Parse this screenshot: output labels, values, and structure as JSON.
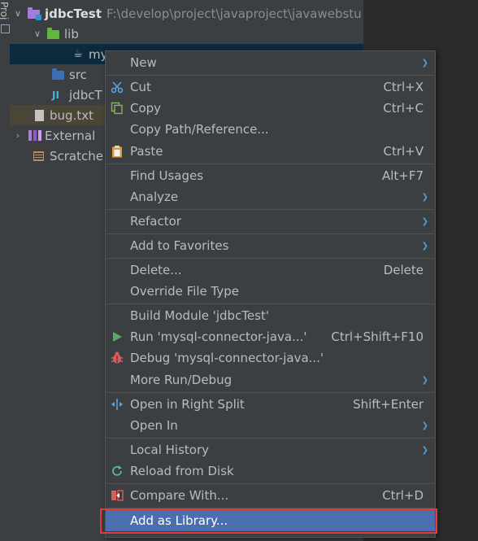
{
  "side_tab": {
    "label": "Proj"
  },
  "tree": {
    "items": [
      {
        "name": "jdbcTest",
        "path": "F:\\develop\\project\\javaproject\\javawebstu"
      },
      {
        "name": "lib"
      },
      {
        "name": "my"
      },
      {
        "name": "src"
      },
      {
        "name": "jdbcT"
      },
      {
        "name": "bug.txt"
      },
      {
        "name": "External"
      },
      {
        "name": "Scratche"
      }
    ]
  },
  "menu": {
    "items": [
      {
        "id": "new",
        "label": "New",
        "shortcut": "",
        "submenu": true
      },
      {
        "id": "cut",
        "label": "Cut",
        "shortcut": "Ctrl+X",
        "icon": "scissors-icon"
      },
      {
        "id": "copy",
        "label": "Copy",
        "shortcut": "Ctrl+C",
        "icon": "copy-icon"
      },
      {
        "id": "copy-path",
        "label": "Copy Path/Reference...",
        "shortcut": ""
      },
      {
        "id": "paste",
        "label": "Paste",
        "shortcut": "Ctrl+V",
        "icon": "clipboard-icon"
      },
      {
        "id": "find-usages",
        "label": "Find Usages",
        "shortcut": "Alt+F7"
      },
      {
        "id": "analyze",
        "label": "Analyze",
        "shortcut": "",
        "submenu": true
      },
      {
        "id": "refactor",
        "label": "Refactor",
        "shortcut": "",
        "submenu": true
      },
      {
        "id": "add-favorites",
        "label": "Add to Favorites",
        "shortcut": "",
        "submenu": true
      },
      {
        "id": "delete",
        "label": "Delete...",
        "shortcut": "Delete"
      },
      {
        "id": "override-type",
        "label": "Override File Type",
        "shortcut": ""
      },
      {
        "id": "build-module",
        "label": "Build Module 'jdbcTest'",
        "shortcut": ""
      },
      {
        "id": "run",
        "label": "Run 'mysql-connector-java...'",
        "shortcut": "Ctrl+Shift+F10",
        "icon": "run-icon"
      },
      {
        "id": "debug",
        "label": "Debug 'mysql-connector-java...'",
        "shortcut": "",
        "icon": "debug-icon"
      },
      {
        "id": "more-run",
        "label": "More Run/Debug",
        "shortcut": "",
        "submenu": true
      },
      {
        "id": "open-right-split",
        "label": "Open in Right Split",
        "shortcut": "Shift+Enter",
        "icon": "split-icon"
      },
      {
        "id": "open-in",
        "label": "Open In",
        "shortcut": "",
        "submenu": true
      },
      {
        "id": "local-history",
        "label": "Local History",
        "shortcut": "",
        "submenu": true
      },
      {
        "id": "reload",
        "label": "Reload from Disk",
        "shortcut": "",
        "icon": "reload-icon"
      },
      {
        "id": "compare",
        "label": "Compare With...",
        "shortcut": "Ctrl+D",
        "icon": "compare-icon"
      },
      {
        "id": "add-library",
        "label": "Add as Library...",
        "shortcut": ""
      }
    ]
  },
  "colors": {
    "highlight": "#4b6eaf",
    "annotation_box": "#e53935",
    "run_green": "#59a869",
    "debug_red": "#db5c5c"
  }
}
